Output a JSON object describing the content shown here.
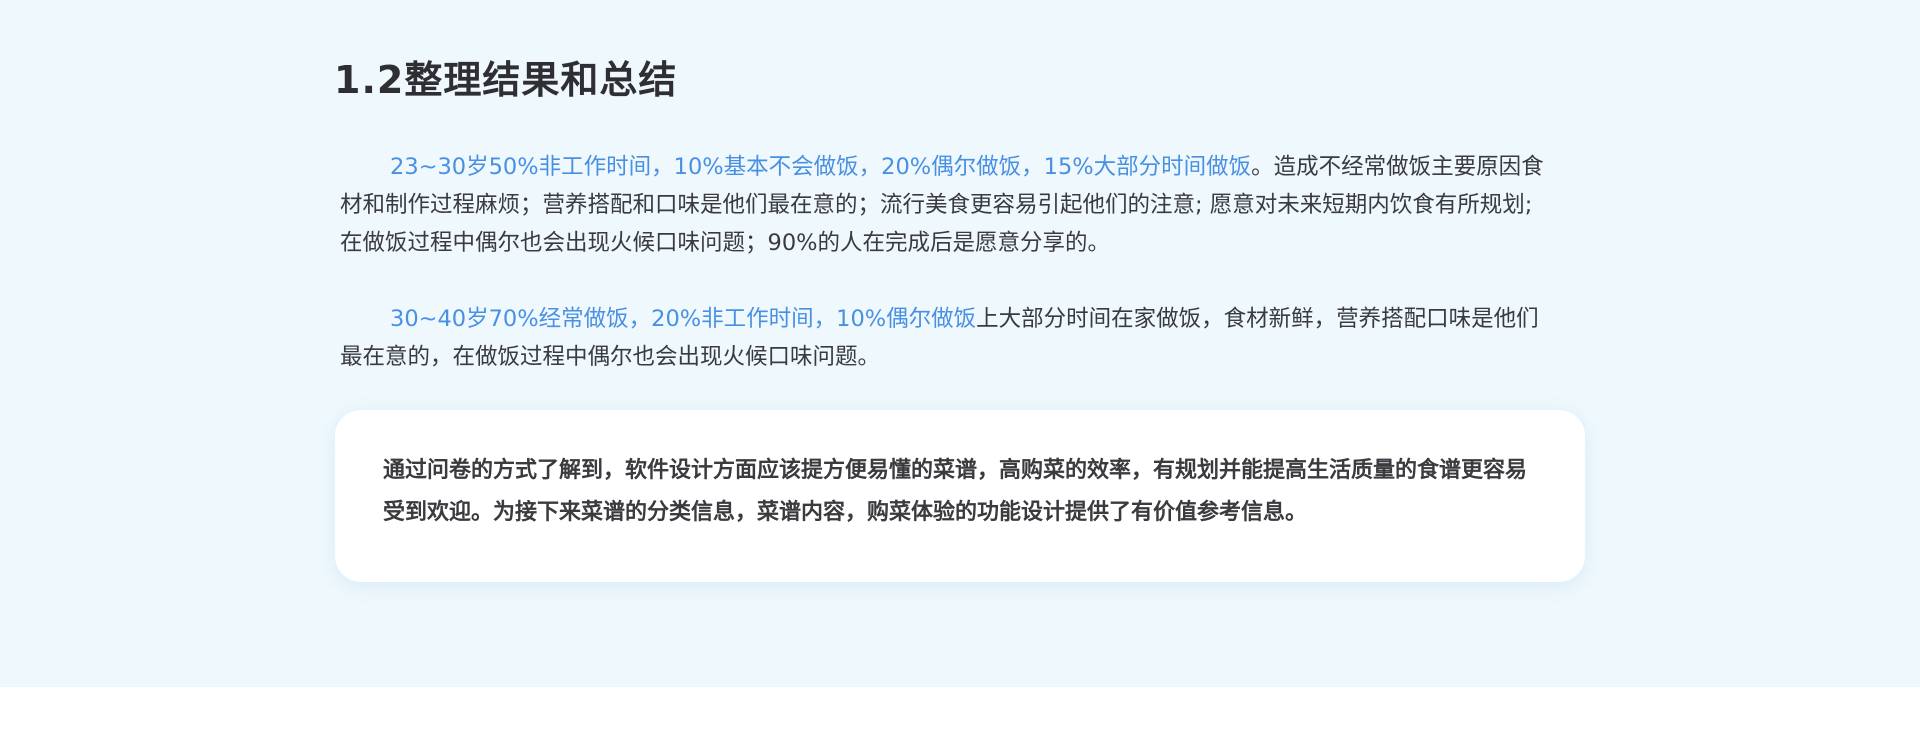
{
  "section": {
    "title": "1.2整理结果和总结"
  },
  "paragraphs": [
    {
      "highlight": "23~30岁50%非工作时间，10%基本不会做饭，20%偶尔做饭，15%大部分时间做饭",
      "text": "。造成不经常做饭主要原因食材和制作过程麻烦；营养搭配和口味是他们最在意的；流行美食更容易引起他们的注意; 愿意对未来短期内饮食有所规划; 在做饭过程中偶尔也会出现火候口味问题；90%的人在完成后是愿意分享的。"
    },
    {
      "highlight": "30~40岁70%经常做饭，20%非工作时间，10%偶尔做饭",
      "text": "上大部分时间在家做饭，食材新鲜，营养搭配口味是他们最在意的，在做饭过程中偶尔也会出现火候口味问题。"
    }
  ],
  "summary_card": {
    "text": "通过问卷的方式了解到，软件设计方面应该提方便易懂的菜谱，高购菜的效率，有规划并能提高生活质量的食谱更容易受到欢迎。为接下来菜谱的分类信息，菜谱内容，购菜体验的功能设计提供了有价值参考信息。"
  },
  "colors": {
    "background": "#eef8fd",
    "highlight": "#4a90e2",
    "text": "#3a3a3f",
    "card": "#ffffff"
  }
}
